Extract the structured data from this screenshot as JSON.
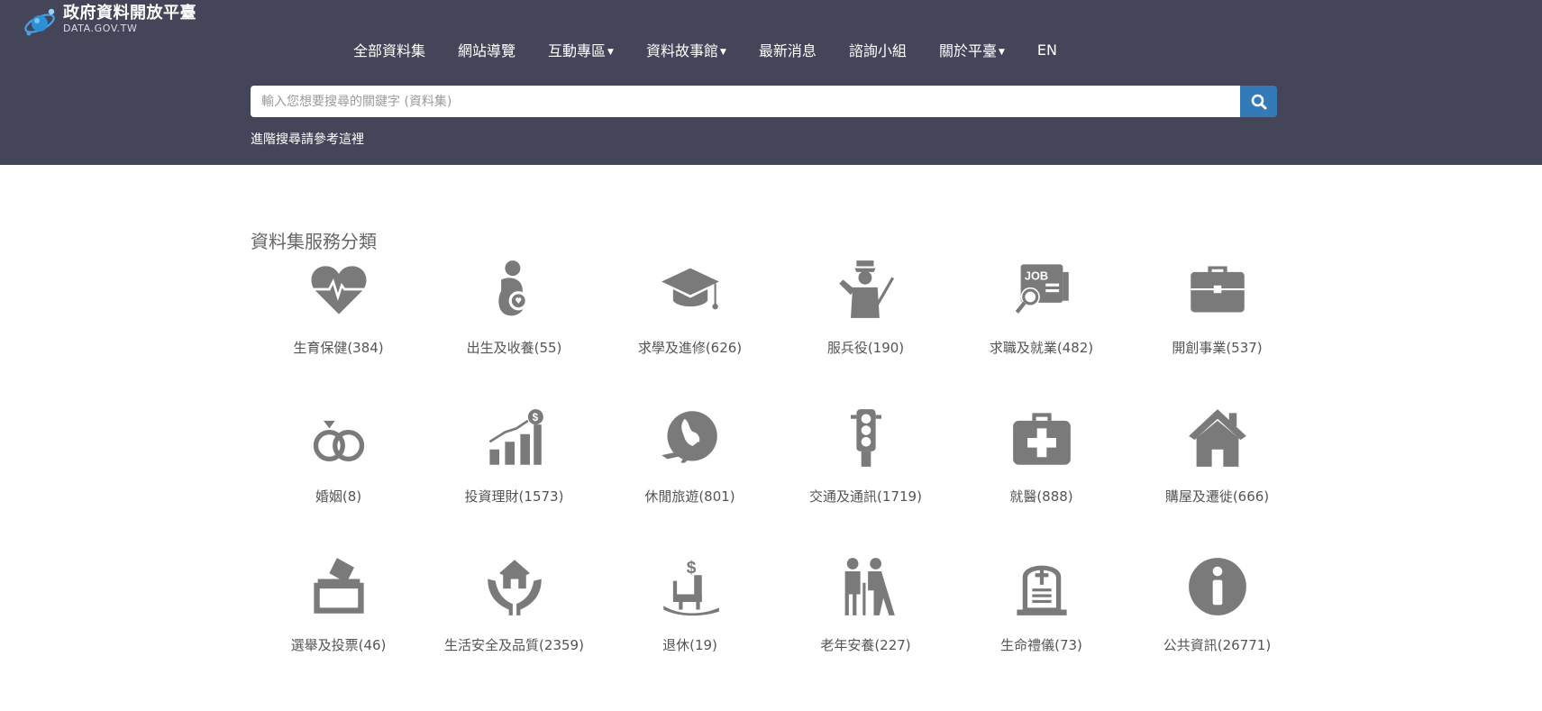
{
  "brand": {
    "title": "政府資料開放平臺",
    "subtitle": "DATA.GOV.TW"
  },
  "nav": [
    {
      "label": "全部資料集",
      "dropdown": false
    },
    {
      "label": "網站導覽",
      "dropdown": false
    },
    {
      "label": "互動專區",
      "dropdown": true
    },
    {
      "label": "資料故事館",
      "dropdown": true
    },
    {
      "label": "最新消息",
      "dropdown": false
    },
    {
      "label": "諮詢小組",
      "dropdown": false
    },
    {
      "label": "關於平臺",
      "dropdown": true
    },
    {
      "label": "EN",
      "dropdown": false
    }
  ],
  "search": {
    "placeholder": "輸入您想要搜尋的關鍵字 (資料集)",
    "value": ""
  },
  "advanced_search_text": "進階搜尋請參考這裡",
  "section_title": "資料集服務分類",
  "colors": {
    "header_bg": "#45455a",
    "search_button": "#337ab7",
    "icon": "#7a7a7a"
  },
  "categories": [
    {
      "label": "生育保健(384)",
      "icon": "heart-pulse-icon"
    },
    {
      "label": "出生及收養(55)",
      "icon": "parent-baby-icon"
    },
    {
      "label": "求學及進修(626)",
      "icon": "graduation-cap-icon"
    },
    {
      "label": "服兵役(190)",
      "icon": "soldier-icon"
    },
    {
      "label": "求職及就業(482)",
      "icon": "job-search-icon"
    },
    {
      "label": "開創事業(537)",
      "icon": "briefcase-icon"
    },
    {
      "label": "婚姻(8)",
      "icon": "rings-icon"
    },
    {
      "label": "投資理財(1573)",
      "icon": "investment-chart-icon"
    },
    {
      "label": "休閒旅遊(801)",
      "icon": "globe-plane-icon"
    },
    {
      "label": "交通及通訊(1719)",
      "icon": "traffic-light-icon"
    },
    {
      "label": "就醫(888)",
      "icon": "medical-kit-icon"
    },
    {
      "label": "購屋及遷徙(666)",
      "icon": "house-icon"
    },
    {
      "label": "選舉及投票(46)",
      "icon": "ballot-box-icon"
    },
    {
      "label": "生活安全及品質(2359)",
      "icon": "hands-house-icon"
    },
    {
      "label": "退休(19)",
      "icon": "rocking-chair-icon"
    },
    {
      "label": "老年安養(227)",
      "icon": "elderly-couple-icon"
    },
    {
      "label": "生命禮儀(73)",
      "icon": "tombstone-icon"
    },
    {
      "label": "公共資訊(26771)",
      "icon": "info-icon"
    }
  ]
}
